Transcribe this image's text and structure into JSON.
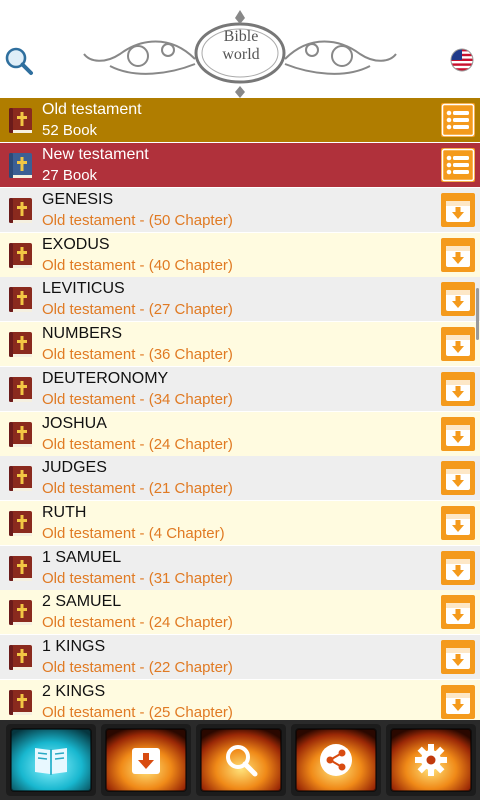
{
  "header": {
    "logo_line1": "Bible",
    "logo_line2": "world",
    "search_icon": "search-icon",
    "language_icon": "us-flag-icon"
  },
  "sections": [
    {
      "title": "Old testament",
      "subtitle": "52 Book",
      "color": "#b07d00"
    },
    {
      "title": "New testament",
      "subtitle": "27 Book",
      "color": "#b0313b"
    }
  ],
  "books": [
    {
      "name": "GENESIS",
      "detail": "Old testament - (50 Chapter)"
    },
    {
      "name": "EXODUS",
      "detail": "Old testament - (40 Chapter)"
    },
    {
      "name": "LEVITICUS",
      "detail": "Old testament - (27 Chapter)"
    },
    {
      "name": "NUMBERS",
      "detail": "Old testament - (36 Chapter)"
    },
    {
      "name": "DEUTERONOMY",
      "detail": "Old testament - (34 Chapter)"
    },
    {
      "name": "JOSHUA",
      "detail": "Old testament - (24 Chapter)"
    },
    {
      "name": "JUDGES",
      "detail": "Old testament - (21 Chapter)"
    },
    {
      "name": "RUTH",
      "detail": "Old testament - (4 Chapter)"
    },
    {
      "name": "1 SAMUEL",
      "detail": "Old testament - (31 Chapter)"
    },
    {
      "name": "2 SAMUEL",
      "detail": "Old testament - (24 Chapter)"
    },
    {
      "name": "1 KINGS",
      "detail": "Old testament - (22 Chapter)"
    },
    {
      "name": "2 KINGS",
      "detail": "Old testament - (25 Chapter)"
    }
  ],
  "colors": {
    "row_odd": "#eeeeee",
    "row_even": "#fffbe0",
    "book_text": "#111111",
    "detail_text": "#e07a23",
    "accent_button": "#f49a1c"
  },
  "bottom_tabs": [
    {
      "icon": "book-icon",
      "active": true
    },
    {
      "icon": "download-icon",
      "active": false
    },
    {
      "icon": "search-icon",
      "active": false
    },
    {
      "icon": "share-icon",
      "active": false
    },
    {
      "icon": "gear-icon",
      "active": false
    }
  ]
}
